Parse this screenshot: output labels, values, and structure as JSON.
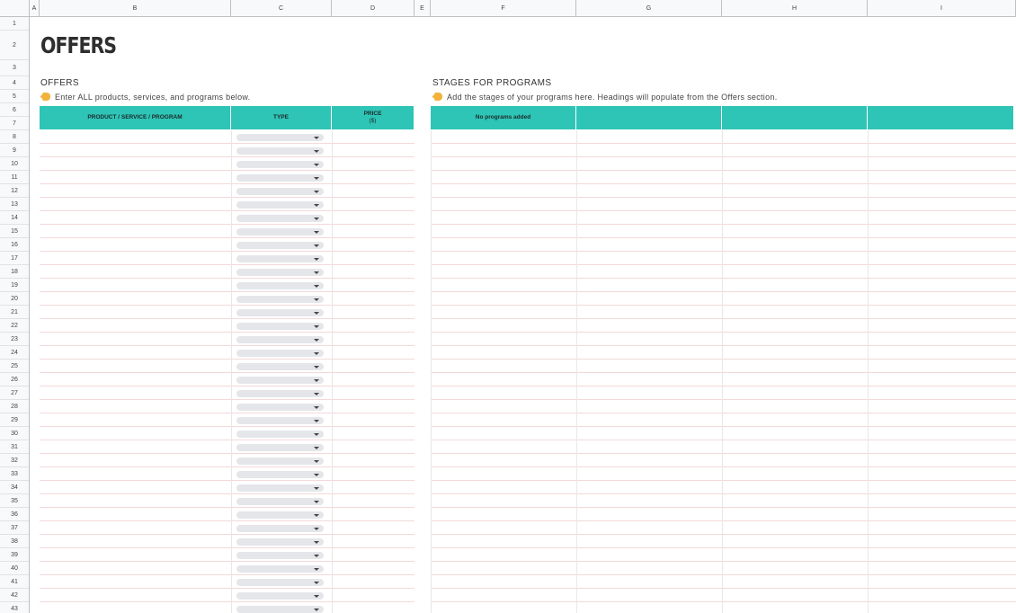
{
  "column_headers": [
    "A",
    "B",
    "C",
    "D",
    "E",
    "F",
    "G",
    "H",
    "I"
  ],
  "row_numbers": [
    "1",
    "2",
    "3",
    "4",
    "5",
    "6",
    "7",
    "8",
    "9",
    "10",
    "11",
    "12",
    "13",
    "14",
    "15",
    "16",
    "17",
    "18",
    "19",
    "20",
    "21",
    "22",
    "23",
    "24",
    "25",
    "26",
    "27",
    "28",
    "29",
    "30",
    "31",
    "32",
    "33",
    "34",
    "35",
    "36",
    "37",
    "38",
    "39",
    "40",
    "41",
    "42",
    "43"
  ],
  "title": "OFFERS",
  "offers": {
    "heading": "OFFERS",
    "hint": "Enter ALL products, services, and programs below.",
    "columns": {
      "product": "PRODUCT / SERVICE / PROGRAM",
      "type": "TYPE",
      "price_line1": "PRICE",
      "price_line2": "($)"
    }
  },
  "stages": {
    "heading": "STAGES FOR PROGRAMS",
    "hint": "Add the stages of your programs here. Headings will populate from the Offers section.",
    "first_header": "No programs added"
  },
  "icons": {
    "hint_icon": "pointing-hand-icon",
    "dropdown_icon": "caret-down-icon"
  },
  "colors": {
    "header_teal": "#2ec4b6",
    "row_line": "#f4d9d9"
  }
}
